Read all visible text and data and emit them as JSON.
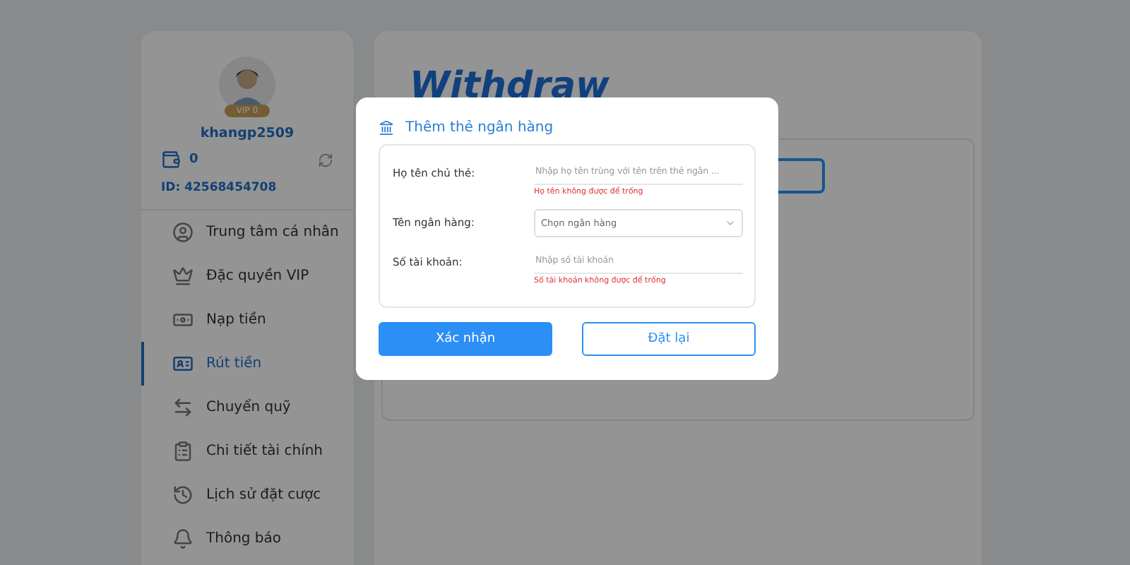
{
  "profile": {
    "badge": "VIP 0",
    "username": "khangp2509",
    "balance": "0",
    "user_id": "ID: 42568454708"
  },
  "sidebar": {
    "items": [
      {
        "label": "Trung tâm cá nhân",
        "selected": false
      },
      {
        "label": "Đặc quyền VIP",
        "selected": false
      },
      {
        "label": "Nạp tiền",
        "selected": false
      },
      {
        "label": "Rút tiền",
        "selected": true
      },
      {
        "label": "Chuyển quỹ",
        "selected": false
      },
      {
        "label": "Chi tiết tài chính",
        "selected": false
      },
      {
        "label": "Lịch sử đặt cược",
        "selected": false
      },
      {
        "label": "Thông báo",
        "selected": false
      }
    ]
  },
  "main": {
    "title": "Withdraw"
  },
  "dialog": {
    "title": "Thêm thẻ ngân hàng",
    "fields": [
      {
        "kind": "text",
        "label": "Họ tên chủ thẻ:",
        "placeholder": "Nhập họ tên trùng với tên trên thẻ ngân ...",
        "error": "Họ tên không được để trống"
      },
      {
        "kind": "select",
        "label": "Tên ngân hàng:",
        "placeholder": "Chọn ngân hàng"
      },
      {
        "kind": "text",
        "label": "Số tài khoản:",
        "placeholder": "Nhập số tài khoản",
        "error": "Số tài khoản không được để trống"
      }
    ],
    "buttons": [
      {
        "kind": "primary",
        "label": "Xác nhận"
      },
      {
        "kind": "secondary",
        "label": "Đặt lại"
      }
    ]
  }
}
